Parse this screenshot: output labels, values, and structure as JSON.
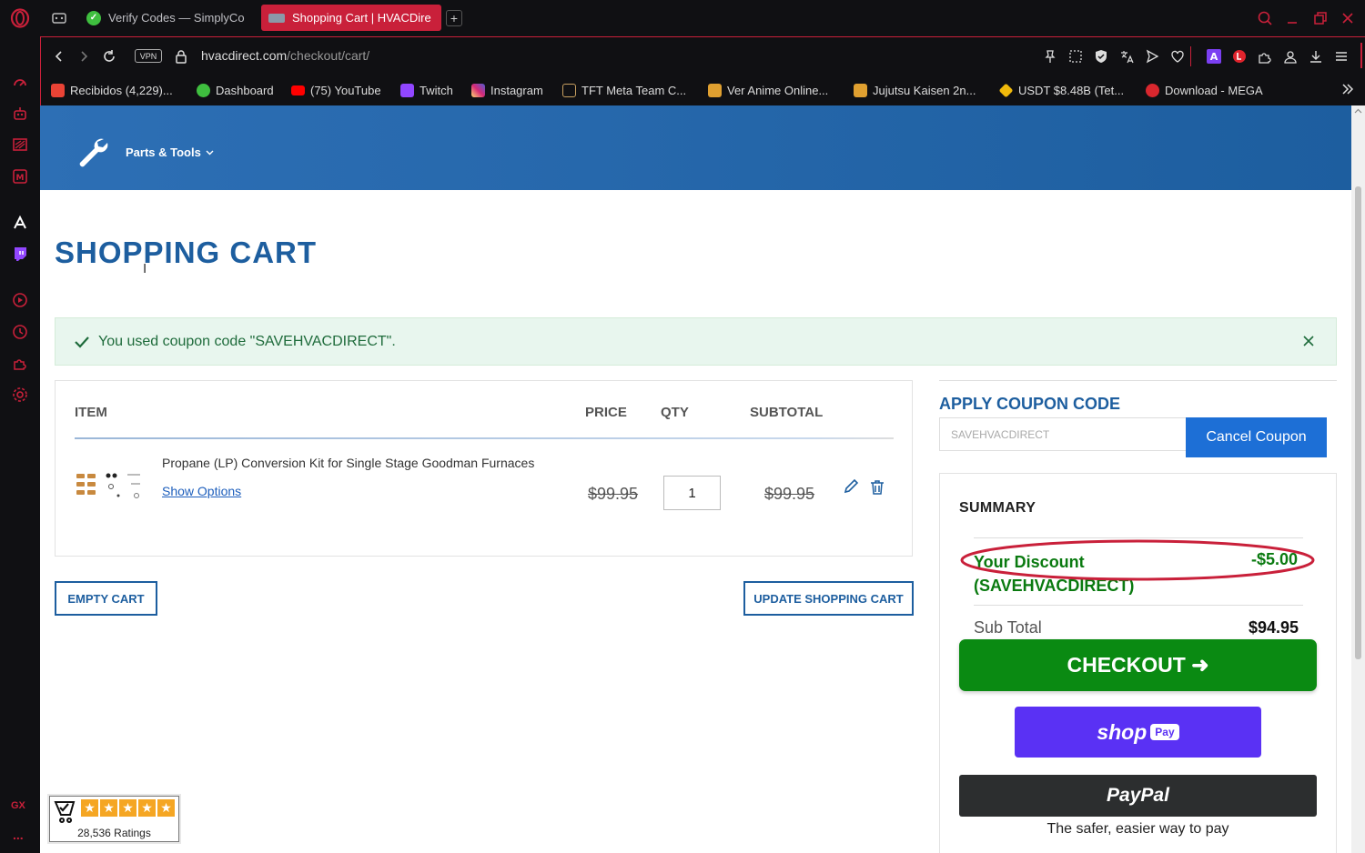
{
  "browser": {
    "tabs": [
      {
        "label": "Verify Codes — SimplyCo",
        "active": false
      },
      {
        "label": "Shopping Cart | HVACDire",
        "active": true
      }
    ],
    "new_tab_label": "+",
    "url_domain": "hvacdirect.com",
    "url_path": "/checkout/cart/",
    "vpn_label": "VPN",
    "bookmarks": [
      {
        "label": "Recibidos (4,229)...",
        "color": "#ea4335"
      },
      {
        "label": "Dashboard",
        "color": "#3fbf3f"
      },
      {
        "label": "(75) YouTube",
        "color": "#ff0000"
      },
      {
        "label": "Twitch",
        "color": "#9146ff"
      },
      {
        "label": "Instagram",
        "color": "#d62976"
      },
      {
        "label": "TFT Meta Team C...",
        "color": "#c8a060"
      },
      {
        "label": "Ver Anime Online...",
        "color": "#e0a030"
      },
      {
        "label": "Jujutsu Kaisen 2n...",
        "color": "#e0a030"
      },
      {
        "label": "USDT $8.48B (Tet...",
        "color": "#f0b90b"
      },
      {
        "label": "Download - MEGA",
        "color": "#d9272e"
      }
    ],
    "sidebar_gx_label": "GX",
    "sidebar_more_label": "..."
  },
  "site": {
    "nav_label": "Parts & Tools",
    "page_title": "SHOPPING CART",
    "coupon_message": "You used coupon code \"SAVEHVACDIRECT\".",
    "table": {
      "headers": {
        "item": "ITEM",
        "price": "PRICE",
        "qty": "QTY",
        "subtotal": "SUBTOTAL"
      },
      "rows": [
        {
          "name": "Propane (LP) Conversion Kit for Single Stage Goodman Furnaces",
          "options_link": "Show Options",
          "price": "$99.95",
          "qty": "1",
          "subtotal": "$99.95"
        }
      ]
    },
    "empty_cart_label": "EMPTY CART",
    "update_cart_label": "UPDATE SHOPPING CART",
    "coupon": {
      "heading": "APPLY COUPON CODE",
      "input_value": "SAVEHVACDIRECT",
      "cancel_label": "Cancel Coupon"
    },
    "summary": {
      "heading": "SUMMARY",
      "discount_label": "Your Discount (SAVEHVACDIRECT)",
      "discount_value": "-$5.00",
      "subtotal_label": "Sub Total",
      "subtotal_value": "$94.95",
      "checkout_label": "CHECKOUT ➜",
      "shoppay_label": "shop",
      "shoppay_badge": "Pay",
      "paypal_label": "PayPal",
      "paypal_tagline": "The safer, easier way to pay"
    },
    "ratings": {
      "stars": 5,
      "count_label": "28,536 Ratings"
    },
    "colors": {
      "brand_blue": "#1d5e9f",
      "checkout_green": "#0a8a12",
      "shoppay_purple": "#5a31f4",
      "alert_bg": "#e8f6ee",
      "alert_text": "#1e6b3b",
      "annotation_red": "#c9203a"
    }
  }
}
